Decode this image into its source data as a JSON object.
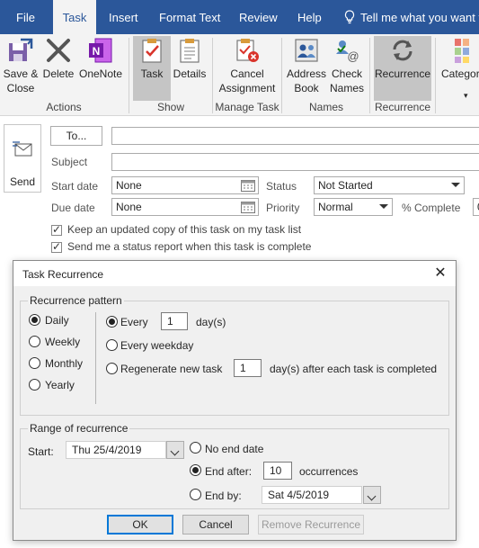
{
  "ribbon_tabs": [
    "File",
    "Task",
    "Insert",
    "Format Text",
    "Review",
    "Help"
  ],
  "tell_me": "Tell me what you want to",
  "ribbon": {
    "save_close_1": "Save &",
    "save_close_2": "Close",
    "delete": "Delete",
    "onenote": "OneNote",
    "task": "Task",
    "details": "Details",
    "cancel_1": "Cancel",
    "cancel_2": "Assignment",
    "address_1": "Address",
    "address_2": "Book",
    "check_1": "Check",
    "check_2": "Names",
    "recurrence": "Recurrence",
    "categorize": "Categor",
    "groups": {
      "actions": "Actions",
      "show": "Show",
      "manage_task": "Manage Task",
      "names": "Names",
      "recurrence": "Recurrence"
    },
    "colors": {
      "tabbar": "#2b579a",
      "selected": "#c5c5c5"
    }
  },
  "form": {
    "send": "Send",
    "to": "To...",
    "subject_label": "Subject",
    "start_date_label": "Start date",
    "start_date": "None",
    "due_date_label": "Due date",
    "due_date": "None",
    "status_label": "Status",
    "status": "Not Started",
    "priority_label": "Priority",
    "priority": "Normal",
    "complete_label": "% Complete",
    "complete_value": "0",
    "keep_copy": "Keep an updated copy of this task on my task list",
    "status_report": "Send me a status report when this task is complete"
  },
  "dialog": {
    "title": "Task Recurrence",
    "pattern_title": "Recurrence pattern",
    "daily": "Daily",
    "weekly": "Weekly",
    "monthly": "Monthly",
    "yearly": "Yearly",
    "every": "Every",
    "every_value": "1",
    "days": "day(s)",
    "every_weekday": "Every weekday",
    "regenerate": "Regenerate new task",
    "regenerate_value": "1",
    "regenerate_suffix": "day(s) after each task is completed",
    "range_title": "Range of recurrence",
    "start_label": "Start:",
    "start_value": "Thu 25/4/2019",
    "no_end": "No end date",
    "end_after": "End after:",
    "end_after_value": "10",
    "occurrences": "occurrences",
    "end_by": "End by:",
    "end_by_value": "Sat 4/5/2019",
    "ok": "OK",
    "cancel": "Cancel",
    "remove": "Remove Recurrence"
  }
}
